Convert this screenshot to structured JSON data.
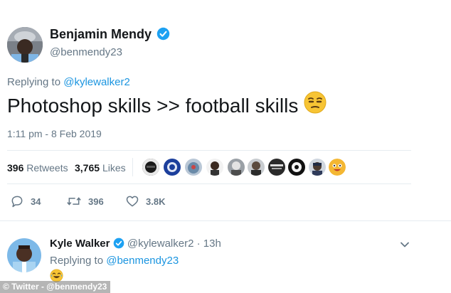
{
  "tweet": {
    "display_name": "Benjamin Mendy",
    "handle": "@benmendy23",
    "replying_prefix": "Replying to ",
    "replying_handle": "@kylewalker2",
    "text": "Photoshop skills >> football skills",
    "emoji": "😒",
    "timestamp": "1:11 pm - 8 Feb 2019",
    "retweets_count": "396",
    "retweets_label": "Retweets",
    "likes_count": "3,765",
    "likes_label": "Likes",
    "actions": {
      "reply_count": "34",
      "retweet_count": "396",
      "like_count": "3.8K"
    }
  },
  "reply": {
    "display_name": "Kyle Walker",
    "handle": "@kylewalker2",
    "separator": "·",
    "age": "13h",
    "replying_prefix": "Replying to ",
    "replying_handle": "@benmendy23",
    "text": "😂"
  },
  "credit": "© Twitter - @benmendy23",
  "colors": {
    "link": "#1b95e0",
    "verified": "#1da1f2",
    "muted": "#657786"
  }
}
